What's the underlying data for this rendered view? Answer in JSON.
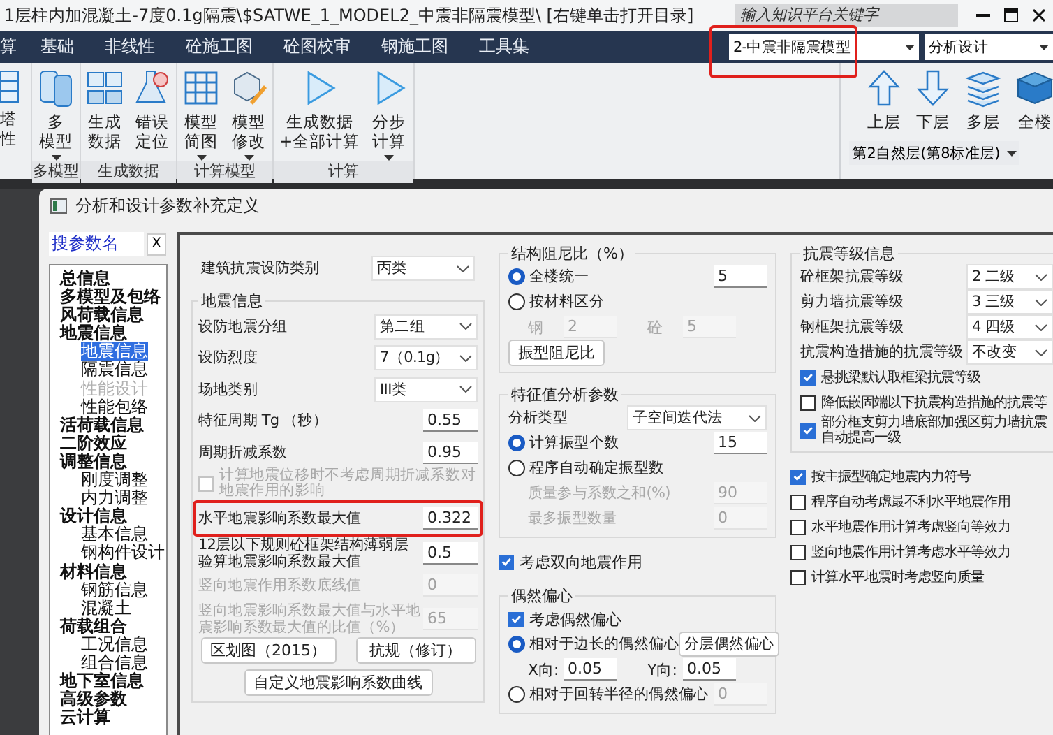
{
  "window": {
    "title": "1层柱内加混凝土-7度0.1g隔震\\$SATWE_1_MODEL2_中震非隔震模型\\ [右键单击打开目录]",
    "search_placeholder": "输入知识平台关键字"
  },
  "menu_tabs": [
    "算",
    "基础",
    "非线性",
    "砼施工图",
    "砼图校审",
    "钢施工图",
    "工具集"
  ],
  "model_combo": {
    "value": "2-中震非隔震模型",
    "highlighted": true
  },
  "mode_combo": {
    "value": "分析设计"
  },
  "ribbon": {
    "groups": [
      {
        "buttons": [
          {
            "lines": [
              "塔",
              "性"
            ],
            "menu": false
          }
        ]
      },
      {
        "label": "多模型",
        "buttons": [
          {
            "lines": [
              "多",
              "模型"
            ],
            "menu": true
          }
        ]
      },
      {
        "label": "生成数据",
        "buttons": [
          {
            "lines": [
              "生成",
              "数据"
            ],
            "menu": false
          },
          {
            "lines": [
              "错误",
              "定位"
            ],
            "menu": false
          }
        ]
      },
      {
        "label": "计算模型",
        "buttons": [
          {
            "lines": [
              "模型",
              "简图"
            ],
            "menu": true
          },
          {
            "lines": [
              "模型",
              "修改"
            ],
            "menu": true
          }
        ]
      },
      {
        "label": "计算",
        "buttons": [
          {
            "lines": [
              "生成数据",
              "+全部计算"
            ],
            "menu": false
          },
          {
            "lines": [
              "分步",
              "计算"
            ],
            "menu": true
          }
        ]
      }
    ]
  },
  "floor": {
    "buttons": [
      "上层",
      "下层",
      "多层",
      "全楼"
    ],
    "combo": "第2自然层(第8标准层)"
  },
  "dialog": {
    "title": "分析和设计参数补充定义",
    "search_value": "搜参数名",
    "clear_label": "X",
    "tree": [
      {
        "label": "总信息",
        "selected": false,
        "disabled": false
      },
      {
        "label": "多模型及包络",
        "selected": false,
        "disabled": false
      },
      {
        "label": "风荷载信息",
        "selected": false,
        "disabled": false
      },
      {
        "label": "地震信息",
        "selected": false,
        "disabled": false,
        "children": [
          {
            "label": "地震信息",
            "selected": true,
            "disabled": false
          },
          {
            "label": "隔震信息",
            "selected": false,
            "disabled": false
          },
          {
            "label": "性能设计",
            "selected": false,
            "disabled": true
          },
          {
            "label": "性能包络",
            "selected": false,
            "disabled": false
          }
        ]
      },
      {
        "label": "活荷载信息",
        "selected": false,
        "disabled": false
      },
      {
        "label": "二阶效应",
        "selected": false,
        "disabled": false
      },
      {
        "label": "调整信息",
        "selected": false,
        "disabled": false,
        "children": [
          {
            "label": "刚度调整",
            "selected": false,
            "disabled": false
          },
          {
            "label": "内力调整",
            "selected": false,
            "disabled": false
          }
        ]
      },
      {
        "label": "设计信息",
        "selected": false,
        "disabled": false,
        "children": [
          {
            "label": "基本信息",
            "selected": false,
            "disabled": false
          },
          {
            "label": "钢构件设计",
            "selected": false,
            "disabled": false
          }
        ]
      },
      {
        "label": "材料信息",
        "selected": false,
        "disabled": false,
        "children": [
          {
            "label": "钢筋信息",
            "selected": false,
            "disabled": false
          },
          {
            "label": "混凝土",
            "selected": false,
            "disabled": false
          }
        ]
      },
      {
        "label": "荷载组合",
        "selected": false,
        "disabled": false,
        "children": [
          {
            "label": "工况信息",
            "selected": false,
            "disabled": false
          },
          {
            "label": "组合信息",
            "selected": false,
            "disabled": false
          }
        ]
      },
      {
        "label": "地下室信息",
        "selected": false,
        "disabled": false
      },
      {
        "label": "高级参数",
        "selected": false,
        "disabled": false
      },
      {
        "label": "云计算",
        "selected": false,
        "disabled": false
      }
    ],
    "columns": [
      {
        "sections": [
          {
            "rows": [
              {
                "kind": "combo",
                "label": "建筑抗震设防类别",
                "value": "丙类"
              }
            ]
          },
          {
            "title": "地震信息",
            "rows": [
              {
                "kind": "combo",
                "label": "设防地震分组",
                "value": "第二组"
              },
              {
                "kind": "combo",
                "label": "设防烈度",
                "value": "7（0.1g）"
              },
              {
                "kind": "combo",
                "label": "场地类别",
                "value": "III类"
              },
              {
                "kind": "input",
                "label": "特征周期 Tg （秒）",
                "value": "0.55",
                "disabled": false,
                "highlighted": false
              },
              {
                "kind": "input",
                "label": "周期折减系数",
                "value": "0.95",
                "disabled": false,
                "highlighted": false
              },
              {
                "kind": "check",
                "label": "计算地震位移时不考虑周期折减系数对地震作用的影响",
                "checked": false,
                "disabled": true
              },
              {
                "kind": "input",
                "label": "水平地震影响系数最大值",
                "value": "0.322",
                "disabled": false,
                "highlighted": true
              },
              {
                "kind": "input",
                "label": "12层以下规则砼框架结构薄弱层验算地震影响系数最大值",
                "value": "0.5",
                "disabled": false,
                "highlighted": false
              },
              {
                "kind": "input",
                "label": "竖向地震作用系数底线值",
                "value": "0",
                "disabled": true,
                "highlighted": false
              },
              {
                "kind": "input",
                "label": "竖向地震影响系数最大值与水平地震影响系数最大值的比值（%）",
                "value": "65",
                "disabled": true,
                "highlighted": false
              },
              {
                "kind": "buttons",
                "buttons": [
                  "区划图（2015）",
                  "抗规（修订）"
                ]
              },
              {
                "kind": "buttons",
                "buttons": [
                  "自定义地震影响系数曲线"
                ]
              }
            ]
          }
        ]
      },
      {
        "sections": [
          {
            "title": "结构阻尼比（%）",
            "rows": [
              {
                "kind": "radio",
                "label": "全楼统一",
                "selected": true,
                "value": "5",
                "field_disabled": false
              },
              {
                "kind": "radio",
                "label": "按材料区分",
                "selected": false
              },
              {
                "kind": "pair",
                "disabled": true,
                "items": [
                  {
                    "label": "钢",
                    "value": "2"
                  },
                  {
                    "label": "砼",
                    "value": "5"
                  }
                ]
              },
              {
                "kind": "buttons",
                "buttons": [
                  "振型阻尼比"
                ]
              }
            ]
          },
          {
            "title": "特征值分析参数",
            "rows": [
              {
                "kind": "combo",
                "label": "分析类型",
                "value": "子空间迭代法"
              },
              {
                "kind": "radio",
                "label": "计算振型个数",
                "selected": true,
                "value": "15",
                "field_disabled": false
              },
              {
                "kind": "radio",
                "label": "程序自动确定振型数",
                "selected": false
              },
              {
                "kind": "input",
                "label": "质量参与系数之和(%)",
                "value": "90",
                "disabled": true,
                "highlighted": false
              },
              {
                "kind": "input",
                "label": "最多振型数量",
                "value": "0",
                "disabled": true,
                "highlighted": false
              }
            ]
          },
          {
            "rows": [
              {
                "kind": "check",
                "label": "考虑双向地震作用",
                "checked": true,
                "disabled": false
              }
            ]
          },
          {
            "title": "偶然偏心",
            "rows": [
              {
                "kind": "check",
                "label": "考虑偶然偏心",
                "checked": true,
                "disabled": false
              },
              {
                "kind": "radio",
                "label": "相对于边长的偶然偏心",
                "selected": true,
                "button": "分层偶然偏心"
              },
              {
                "kind": "pair",
                "disabled": false,
                "items": [
                  {
                    "label": "X向:",
                    "value": "0.05"
                  },
                  {
                    "label": "Y向:",
                    "value": "0.05"
                  }
                ]
              },
              {
                "kind": "radio",
                "label": "相对于回转半径的偶然偏心",
                "selected": false,
                "value": "0",
                "field_disabled": true
              }
            ]
          }
        ]
      },
      {
        "sections": [
          {
            "title": "抗震等级信息",
            "rows": [
              {
                "kind": "combo",
                "label": "砼框架抗震等级",
                "value": "2  二级"
              },
              {
                "kind": "combo",
                "label": "剪力墙抗震等级",
                "value": "3  三级"
              },
              {
                "kind": "combo",
                "label": "钢框架抗震等级",
                "value": "4  四级"
              },
              {
                "kind": "combo",
                "label": "抗震构造措施的抗震等级",
                "value": "不改变"
              },
              {
                "kind": "check",
                "label": "悬挑梁默认取框梁抗震等级",
                "checked": true,
                "disabled": false
              },
              {
                "kind": "check",
                "label": "降低嵌固端以下抗震构造措施的抗震等",
                "checked": false,
                "disabled": false
              },
              {
                "kind": "check",
                "lines": [
                  "部分框支剪力墙底部加强区剪力墙抗震",
                  "自动提高一级"
                ],
                "checked": true,
                "disabled": false
              }
            ]
          },
          {
            "rows": [
              {
                "kind": "check",
                "label": "按主振型确定地震内力符号",
                "checked": true,
                "disabled": false
              },
              {
                "kind": "check",
                "label": "程序自动考虑最不利水平地震作用",
                "checked": false,
                "disabled": false
              },
              {
                "kind": "check",
                "label": "水平地震作用计算考虑竖向等效力",
                "checked": false,
                "disabled": false
              },
              {
                "kind": "check",
                "label": "竖向地震作用计算考虑水平等效力",
                "checked": false,
                "disabled": false
              },
              {
                "kind": "check",
                "label": "计算水平地震时考虑竖向质量",
                "checked": false,
                "disabled": false
              }
            ]
          }
        ]
      }
    ]
  }
}
